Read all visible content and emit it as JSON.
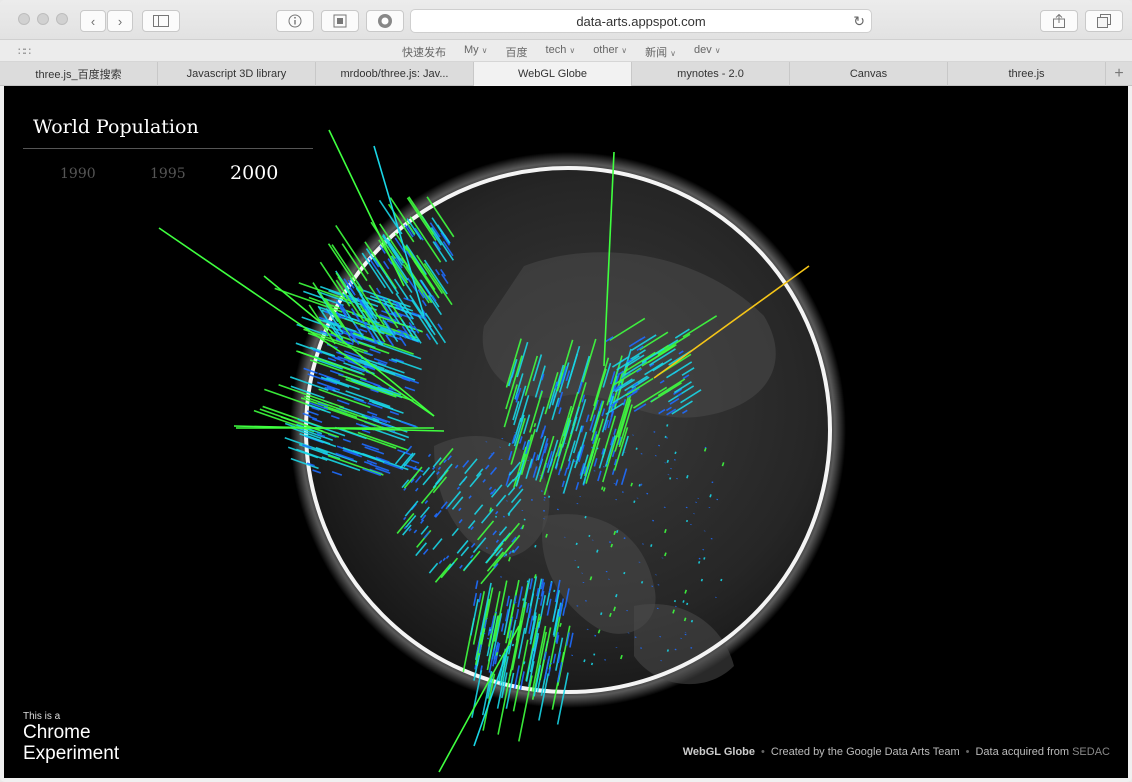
{
  "browser": {
    "url": "data-arts.appspot.com",
    "favorites": [
      {
        "label": "快速发布",
        "menu": false
      },
      {
        "label": "My",
        "menu": true
      },
      {
        "label": "百度",
        "menu": false
      },
      {
        "label": "tech",
        "menu": true
      },
      {
        "label": "other",
        "menu": true
      },
      {
        "label": "新闻",
        "menu": true
      },
      {
        "label": "dev",
        "menu": true
      }
    ],
    "tabs": [
      "three.js_百度搜索",
      "Javascript 3D library",
      "mrdoob/three.js: Jav...",
      "WebGL Globe",
      "mynotes - 2.0",
      "Canvas",
      "three.js"
    ],
    "active_tab": 3
  },
  "page": {
    "title": "World Population",
    "years": [
      "1990",
      "1995",
      "2000"
    ],
    "selected_year": "2000",
    "badge_small": "This is a",
    "badge_line1": "Chrome",
    "badge_line2": "Experiment",
    "footer_brand": "WebGL Globe",
    "footer_created": "Created by the Google Data Arts Team",
    "footer_data": "Data acquired from",
    "footer_source": "SEDAC"
  },
  "colors": {
    "bar_low": "#1e6cff",
    "bar_mid": "#19d6e6",
    "bar_high": "#3fff3f",
    "bar_peak": "#f5c518"
  }
}
